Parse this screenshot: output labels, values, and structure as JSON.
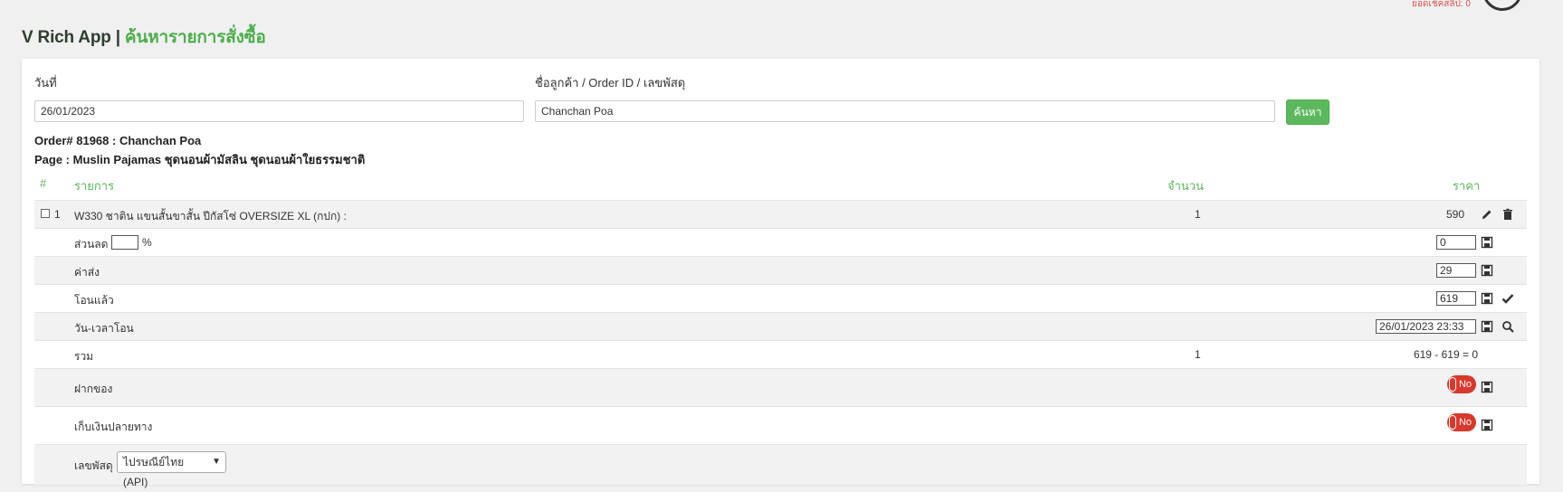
{
  "top_status": "ยอดเช็คสลิป: 0",
  "header": {
    "app": "V Rich App |",
    "subtitle": "ค้นหารายการสั่งซื้อ"
  },
  "search": {
    "date_label": "วันที่",
    "date_value": "26/01/2023",
    "customer_label": "ชื่อลูกค้า / Order ID / เลขพัสดุ",
    "customer_value": "Chanchan Poa",
    "button": "ค้นหา"
  },
  "order": {
    "title": "Order# 81968 : Chanchan Poa",
    "page": "Page : Muslin Pajamas ชุดนอนผ้ามัสลิน ชุดนอนผ้าใยธรรมชาติ"
  },
  "table": {
    "headers": {
      "num": "#",
      "item": "รายการ",
      "qty": "จำนวน",
      "price": "ราคา"
    },
    "item": {
      "num": "1",
      "name": "W330 ชาติน แขนสั้นขาสั้น ปีกัสโซ่ OVERSIZE XL (กปก) :",
      "qty": "1",
      "price": "590"
    },
    "discount": {
      "label": "ส่วนลด",
      "percent_value": "",
      "percent_sign": "%",
      "value": "0"
    },
    "shipping": {
      "label": "ค่าส่ง",
      "value": "29"
    },
    "paid": {
      "label": "โอนแล้ว",
      "value": "619"
    },
    "paid_time": {
      "label": "วัน-เวลาโอน",
      "value": "26/01/2023 23:33"
    },
    "total": {
      "label": "รวม",
      "qty": "1",
      "calc": "619 - 619 = 0"
    },
    "deposit": {
      "label": "ฝากของ",
      "toggle": "No"
    },
    "cod": {
      "label": "เก็บเงินปลายทาง",
      "toggle": "No"
    },
    "tracking": {
      "label": "เลขพัสดุ",
      "carrier": "ไปรษณีย์ไทย (API)"
    }
  },
  "colors": {
    "accent": "#5cb85c",
    "danger": "#d9382c"
  }
}
